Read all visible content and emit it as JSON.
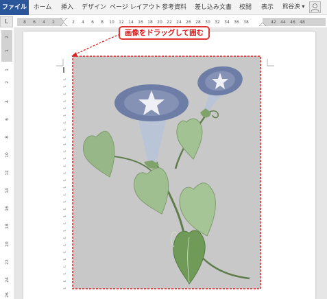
{
  "ribbon": {
    "tabs": [
      "ファイル",
      "ホーム",
      "挿入",
      "デザイン",
      "ページ レイアウト",
      "参考資料",
      "差し込み文書",
      "校閲",
      "表示"
    ],
    "user_name": "熊谷泱 ▾"
  },
  "ruler": {
    "corner_label": "L",
    "horizontal_ticks": [
      "8",
      "6",
      "4",
      "2",
      "2",
      "4",
      "6",
      "8",
      "10",
      "12",
      "14",
      "16",
      "18",
      "20",
      "22",
      "24",
      "26",
      "28",
      "30",
      "32",
      "34",
      "36",
      "38",
      "42",
      "44",
      "46",
      "48"
    ],
    "vertical_ticks": [
      "2",
      "1",
      "1",
      "2",
      "4",
      "6",
      "8",
      "10",
      "12",
      "14",
      "16",
      "18",
      "20",
      "22",
      "24",
      "26"
    ]
  },
  "callout": {
    "text": "画像をドラッグして囲む"
  },
  "colors": {
    "file_tab": "#2b579a",
    "callout_red": "#e03030",
    "image_bg": "#c8c8c8",
    "leaf_green": "#8fb07a"
  },
  "image": {
    "subject": "morning-glory illustration"
  }
}
